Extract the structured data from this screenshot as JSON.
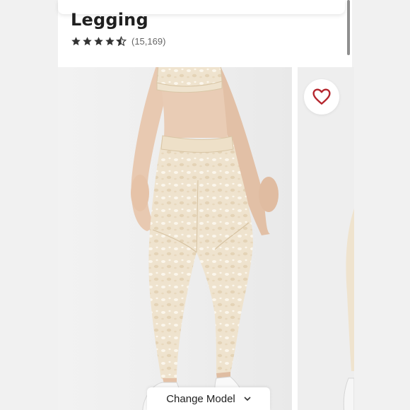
{
  "product": {
    "title": "Legging",
    "rating_stars": 4.5,
    "review_count": "(15,169)"
  },
  "gallery": {
    "favorite_icon": "heart-outline-icon",
    "change_model_label": "Change Model",
    "change_model_icon": "chevron-down-icon"
  },
  "colors": {
    "heart": "#b5262e",
    "star": "#333333",
    "legging": "#efe2cc"
  }
}
